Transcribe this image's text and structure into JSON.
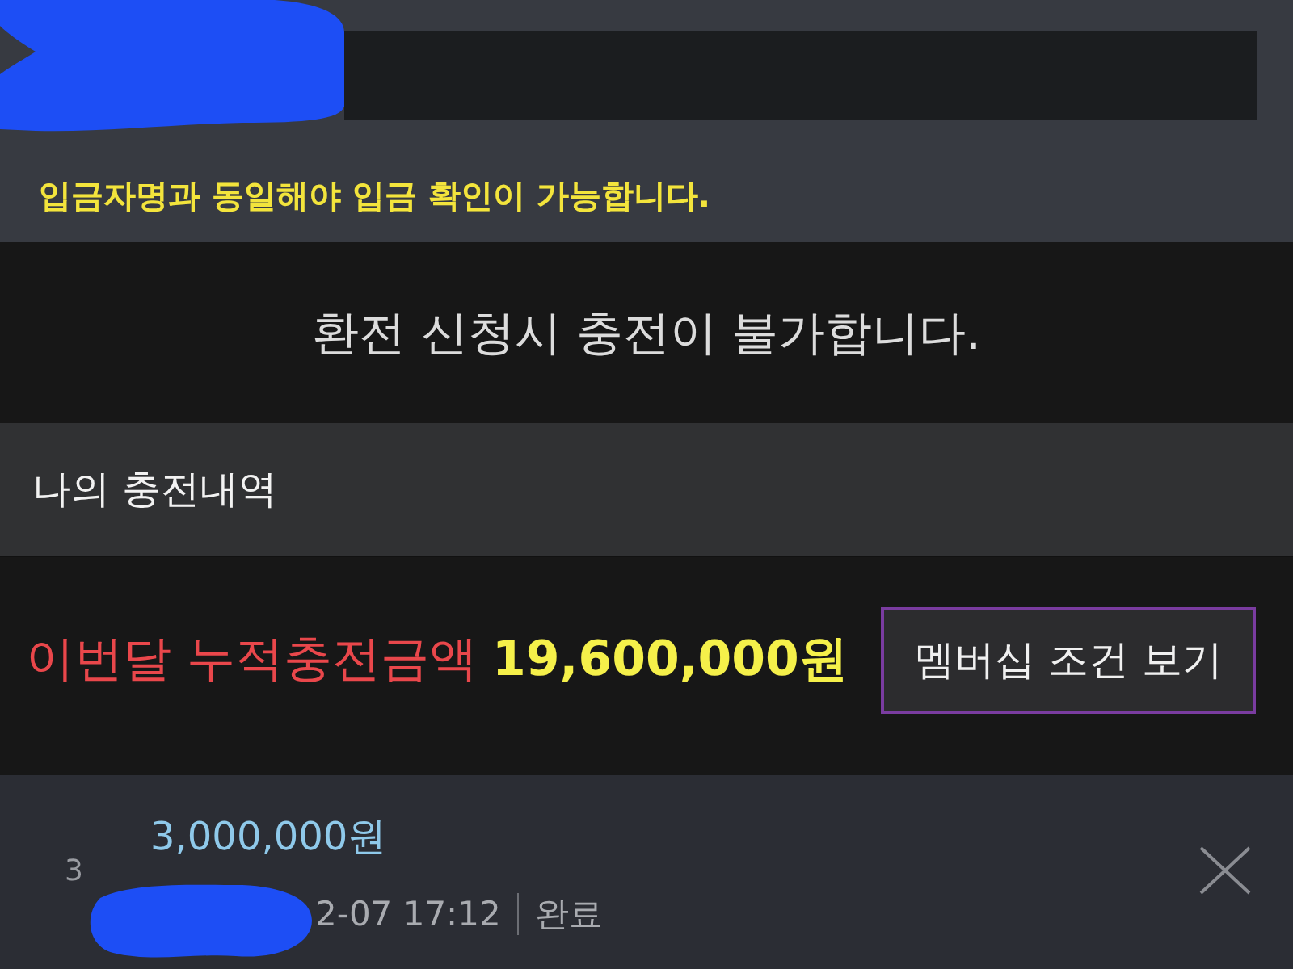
{
  "deposit_field": {
    "redacted": true,
    "note": "입금자명과 동일해야 입금 확인이 가능합니다."
  },
  "exchange_notice": "환전 신청시 충전이 불가합니다.",
  "history": {
    "title": "나의 충전내역",
    "monthly_total": {
      "label": "이번달 누적충전금액",
      "amount": "19,600,000원"
    },
    "membership_button": "멤버십 조건 보기",
    "entries": [
      {
        "index": "3",
        "amount": "3,000,000원",
        "redacted": true,
        "datetime": "2-07 17:12",
        "status": "완료"
      }
    ]
  }
}
